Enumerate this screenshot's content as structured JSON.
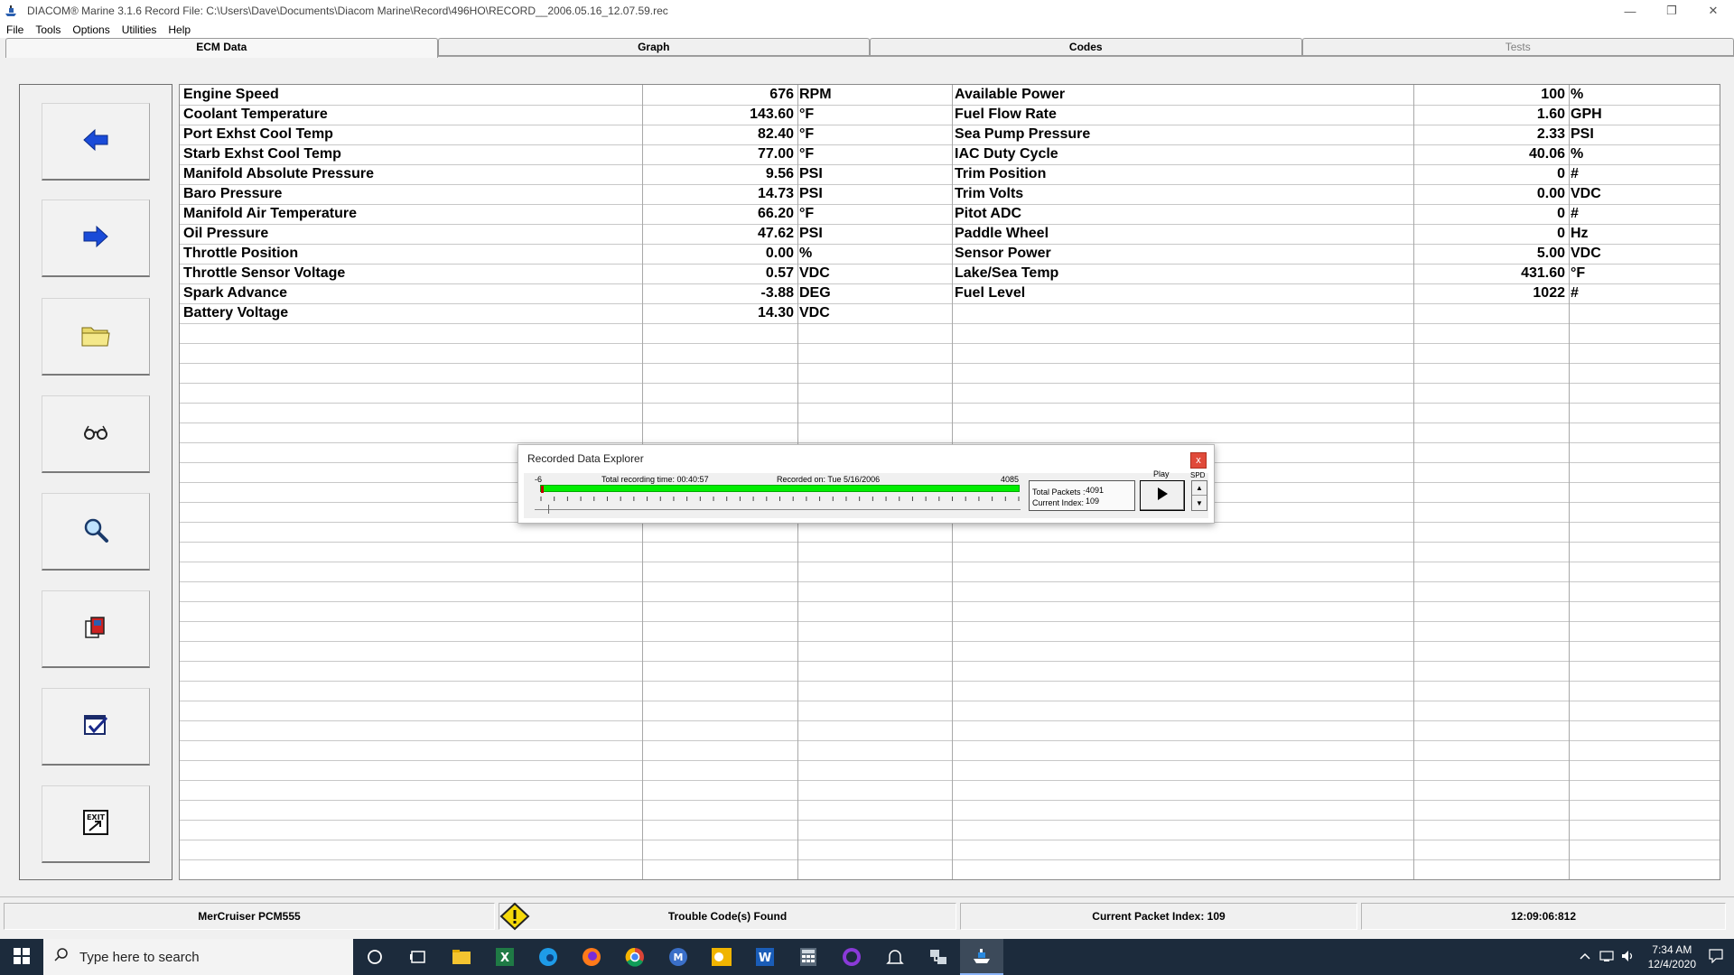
{
  "window": {
    "title": "DIACOM® Marine 3.1.6    Record File: C:\\Users\\Dave\\Documents\\Diacom Marine\\Record\\496HO\\RECORD__2006.05.16_12.07.59.rec",
    "minimize": "—",
    "restore": "❐",
    "close": "✕"
  },
  "menu": [
    "File",
    "Tools",
    "Options",
    "Utilities",
    "Help"
  ],
  "tabs": [
    {
      "label": "ECM Data",
      "state": "active"
    },
    {
      "label": "Graph",
      "state": "normal"
    },
    {
      "label": "Codes",
      "state": "normal"
    },
    {
      "label": "Tests",
      "state": "disabled"
    }
  ],
  "toolbar_icons": [
    "back-arrow-icon",
    "forward-arrow-icon",
    "open-folder-icon",
    "glasses-icon",
    "magnifier-icon",
    "manual-book-icon",
    "checklist-icon",
    "exit-icon"
  ],
  "data_left": [
    {
      "name": "Engine Speed",
      "value": "676",
      "unit": "RPM"
    },
    {
      "name": "Coolant Temperature",
      "value": "143.60",
      "unit": "°F"
    },
    {
      "name": "Port Exhst Cool Temp",
      "value": "82.40",
      "unit": "°F"
    },
    {
      "name": "Starb Exhst Cool Temp",
      "value": "77.00",
      "unit": "°F"
    },
    {
      "name": "Manifold Absolute Pressure",
      "value": "9.56",
      "unit": "PSI"
    },
    {
      "name": "Baro Pressure",
      "value": "14.73",
      "unit": "PSI"
    },
    {
      "name": "Manifold Air Temperature",
      "value": "66.20",
      "unit": "°F"
    },
    {
      "name": "Oil Pressure",
      "value": "47.62",
      "unit": "PSI"
    },
    {
      "name": "Throttle Position",
      "value": "0.00",
      "unit": "%"
    },
    {
      "name": "Throttle Sensor Voltage",
      "value": "0.57",
      "unit": "VDC"
    },
    {
      "name": "Spark Advance",
      "value": "-3.88",
      "unit": "DEG"
    },
    {
      "name": "Battery Voltage",
      "value": "14.30",
      "unit": "VDC"
    }
  ],
  "data_right": [
    {
      "name": "Available Power",
      "value": "100",
      "unit": "%"
    },
    {
      "name": "Fuel Flow Rate",
      "value": "1.60",
      "unit": "GPH"
    },
    {
      "name": "Sea Pump Pressure",
      "value": "2.33",
      "unit": "PSI"
    },
    {
      "name": "IAC Duty Cycle",
      "value": "40.06",
      "unit": "%"
    },
    {
      "name": "Trim Position",
      "value": "0",
      "unit": "#"
    },
    {
      "name": "Trim Volts",
      "value": "0.00",
      "unit": "VDC"
    },
    {
      "name": "Pitot ADC",
      "value": "0",
      "unit": "#"
    },
    {
      "name": "Paddle Wheel",
      "value": "0",
      "unit": "Hz"
    },
    {
      "name": "Sensor Power",
      "value": "5.00",
      "unit": "VDC"
    },
    {
      "name": "Lake/Sea Temp",
      "value": "431.60",
      "unit": "°F"
    },
    {
      "name": "Fuel Level",
      "value": "1022",
      "unit": "#"
    }
  ],
  "explorer": {
    "title": "Recorded Data Explorer",
    "close": "x",
    "range_start": "-6",
    "range_end": "4085",
    "total_time": "Total recording time:  00:40:57",
    "recorded_on": "Recorded on:  Tue  5/16/2006",
    "total_packets_label": "Total Packets :",
    "total_packets": "4091",
    "current_index_label": "Current Index:",
    "current_index": "109",
    "play_label": "Play",
    "spd_label": "SPD",
    "progress_fraction": 0.027
  },
  "status": {
    "ecm": "MerCruiser PCM555",
    "codes": "Trouble Code(s) Found",
    "packet": "Current Packet Index: 109",
    "time": "12:09:06:812"
  },
  "taskbar": {
    "search_placeholder": "Type here to search",
    "time": "7:34 AM",
    "date": "12/4/2020",
    "apps": [
      "cortana-icon",
      "task-view-icon",
      "file-explorer-icon",
      "excel-icon",
      "edge-icon",
      "firefox-icon",
      "chrome-icon",
      "m-app-icon",
      "outlook-icon",
      "word-icon",
      "calculator-icon",
      "ring-app-icon",
      "bell-app-icon",
      "network-tool-icon",
      "diacom-icon"
    ]
  },
  "colors": {
    "progress_green": "#00ee00",
    "arrow_blue": "#1a4bd8",
    "warning_yellow": "#f5d90a",
    "taskbar_bg": "#1c2b3c"
  }
}
